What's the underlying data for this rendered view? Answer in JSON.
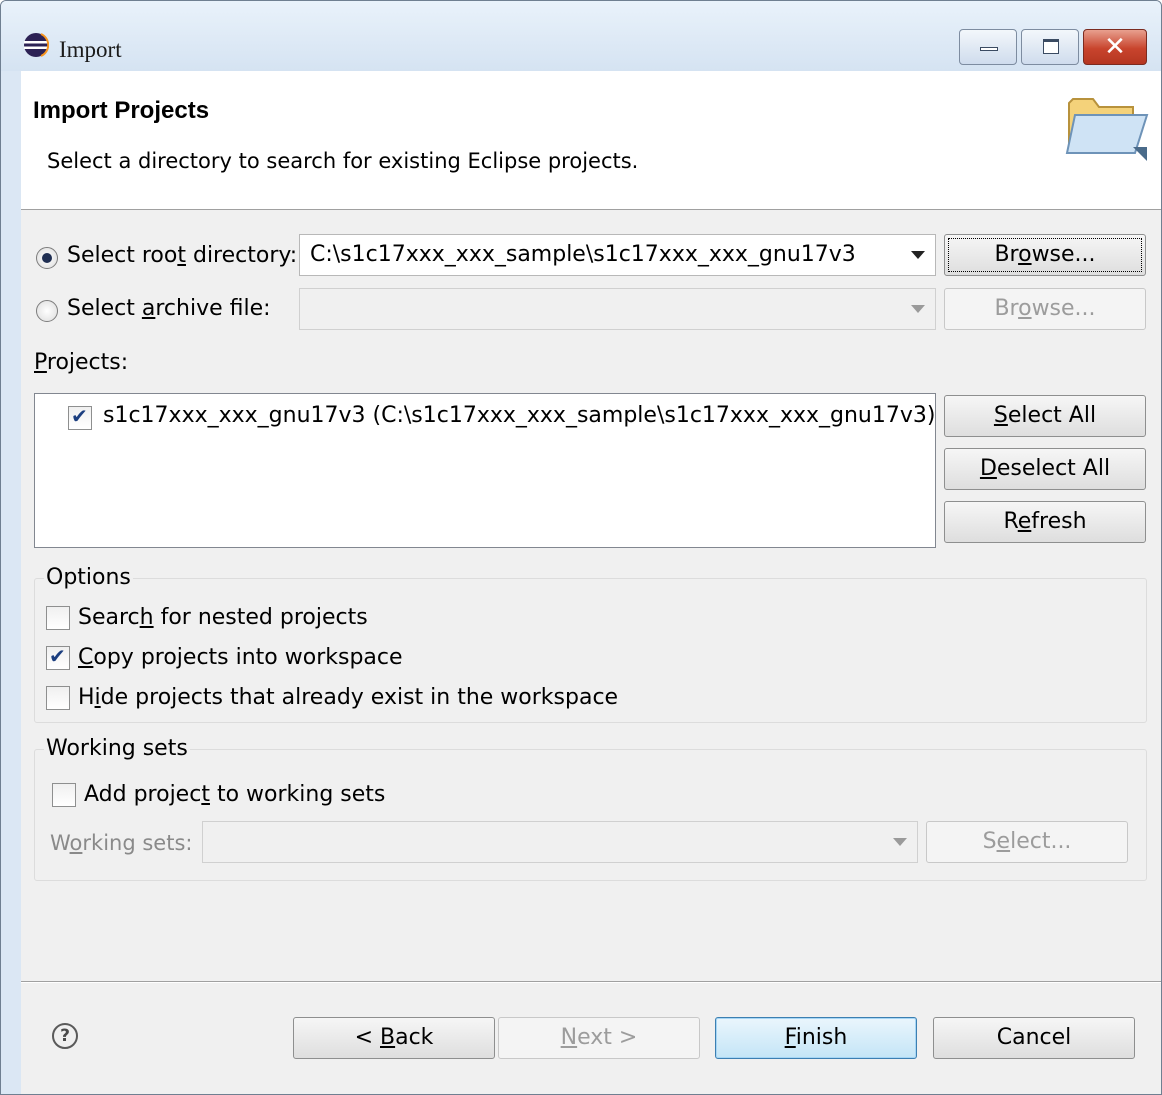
{
  "window": {
    "title": "Import",
    "minimize_icon": "minimize-icon",
    "maximize_icon": "maximize-icon",
    "close_icon": "close-icon",
    "close_label": "✕"
  },
  "header": {
    "title": "Import Projects",
    "description": "Select a directory to search for existing Eclipse projects.",
    "icon": "folder-open-icon"
  },
  "source": {
    "root_directory": {
      "label_before": "Select roo",
      "label_mnemonic": "t",
      "label_after": " directory:",
      "selected": true,
      "value": "C:\\s1c17xxx_xxx_sample\\s1c17xxx_xxx_gnu17v3",
      "browse_before": "Br",
      "browse_mnemonic": "o",
      "browse_after": "wse..."
    },
    "archive_file": {
      "label_before": "Select ",
      "label_mnemonic": "a",
      "label_after": "rchive file:",
      "selected": false,
      "value": "",
      "browse_before": "Br",
      "browse_mnemonic": "o",
      "browse_after": "wse..."
    }
  },
  "projects": {
    "label_mnemonic": "P",
    "label_after": "rojects:",
    "items": [
      {
        "checked": true,
        "label": "s1c17xxx_xxx_gnu17v3 (C:\\s1c17xxx_xxx_sample\\s1c17xxx_xxx_gnu17v3)"
      }
    ],
    "select_all": {
      "mnemonic": "S",
      "after": "elect All"
    },
    "deselect_all": {
      "mnemonic": "D",
      "after": "eselect All"
    },
    "refresh": {
      "before": "R",
      "mnemonic": "e",
      "after": "fresh"
    }
  },
  "options": {
    "title": "Options",
    "search_nested": {
      "checked": false,
      "before": "Searc",
      "mnemonic": "h",
      "after": " for nested projects"
    },
    "copy_projects": {
      "checked": true,
      "before": "",
      "mnemonic": "C",
      "after": "opy projects into workspace"
    },
    "hide_existing": {
      "checked": false,
      "before": "H",
      "mnemonic": "i",
      "after": "de projects that already exist in the workspace"
    }
  },
  "working_sets": {
    "title": "Working sets",
    "add_to_sets": {
      "checked": false,
      "before": "Add projec",
      "mnemonic": "t",
      "after": " to working sets"
    },
    "combo_label_before": "W",
    "combo_label_mnemonic": "o",
    "combo_label_after": "rking sets:",
    "combo_value": "",
    "select_before": "S",
    "select_mnemonic": "e",
    "select_after": "lect..."
  },
  "footer": {
    "help_label": "?",
    "back": {
      "before": "< ",
      "mnemonic": "B",
      "after": "ack"
    },
    "next": {
      "before": "",
      "mnemonic": "N",
      "after": "ext >"
    },
    "finish": {
      "before": "",
      "mnemonic": "F",
      "after": "inish"
    },
    "cancel": "Cancel"
  },
  "colors": {
    "title_bar": "#dbe7f4",
    "close_button": "#c8442d",
    "default_button_border": "#3c7fb1",
    "checkmark": "#1c3f80"
  }
}
